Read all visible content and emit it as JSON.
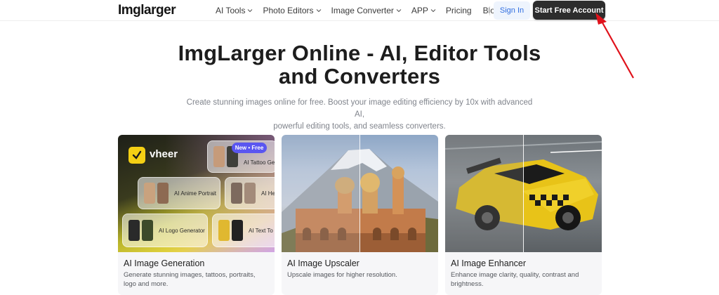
{
  "nav": {
    "logo": "Imglarger",
    "menu": [
      {
        "label": "AI Tools",
        "dropdown": true
      },
      {
        "label": "Photo Editors",
        "dropdown": true
      },
      {
        "label": "Image Converter",
        "dropdown": true
      },
      {
        "label": "APP",
        "dropdown": true
      },
      {
        "label": "Pricing",
        "dropdown": false
      },
      {
        "label": "Blog",
        "dropdown": false
      }
    ],
    "sign_in": "Sign In",
    "start_free": "Start Free Account"
  },
  "hero": {
    "title_line1": "ImgLarger Online - AI, Editor Tools",
    "title_line2": "and Converters",
    "subtitle_line1": "Create stunning images online for free. Boost your image editing efficiency by 10x with advanced AI,",
    "subtitle_line2": "powerful editing tools, and seamless converters."
  },
  "cards": [
    {
      "title": "AI Image Generation",
      "desc": "Generate stunning images, tattoos, portraits, logo and more.",
      "promo": {
        "brand": "vheer",
        "badge": "New • Free",
        "tiles": [
          "AI Tattoo Ge",
          "AI Anime Portrait",
          "AI He",
          "AI Logo Generator",
          "AI Text To"
        ]
      }
    },
    {
      "title": "AI Image Upscaler",
      "desc": "Upscale images for higher resolution."
    },
    {
      "title": "AI Image Enhancer",
      "desc": "Enhance image clarity, quality, contrast and brightness."
    }
  ],
  "colors": {
    "accent_dark": "#2d2d2d",
    "signin_blue": "#2f6de0",
    "arrow_red": "#e0121b",
    "vheer_yellow": "#f4cf14",
    "badge_purple": "#5a56f0"
  },
  "icons": [
    "chevron-down-icon",
    "check-icon",
    "red-arrow-annotation"
  ]
}
